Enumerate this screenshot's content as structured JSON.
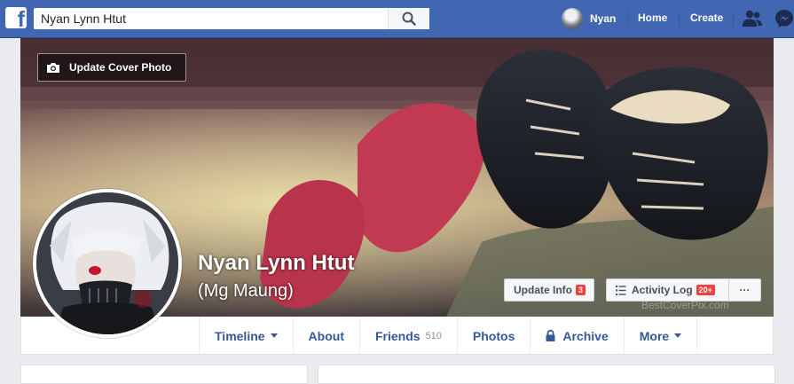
{
  "header": {
    "search_value": "Nyan Lynn Htut",
    "user_name": "Nyan",
    "home_label": "Home",
    "create_label": "Create"
  },
  "cover": {
    "update_cover_label": "Update Cover Photo",
    "watermark": "BestCoverPix.com"
  },
  "profile": {
    "name": "Nyan Lynn Htut",
    "alternate_name": "(Mg Maung)"
  },
  "actions": {
    "update_info_label": "Update Info",
    "update_info_badge": "3",
    "activity_log_label": "Activity Log",
    "activity_log_badge": "20+",
    "more_label": "···"
  },
  "tabs": [
    {
      "label": "Timeline"
    },
    {
      "label": "About"
    },
    {
      "label": "Friends",
      "count": "510"
    },
    {
      "label": "Photos"
    },
    {
      "label": "Archive"
    },
    {
      "label": "More"
    }
  ],
  "colors": {
    "brand_blue": "#4267b2",
    "link_blue": "#365899",
    "badge_red": "#fa3e3e"
  }
}
